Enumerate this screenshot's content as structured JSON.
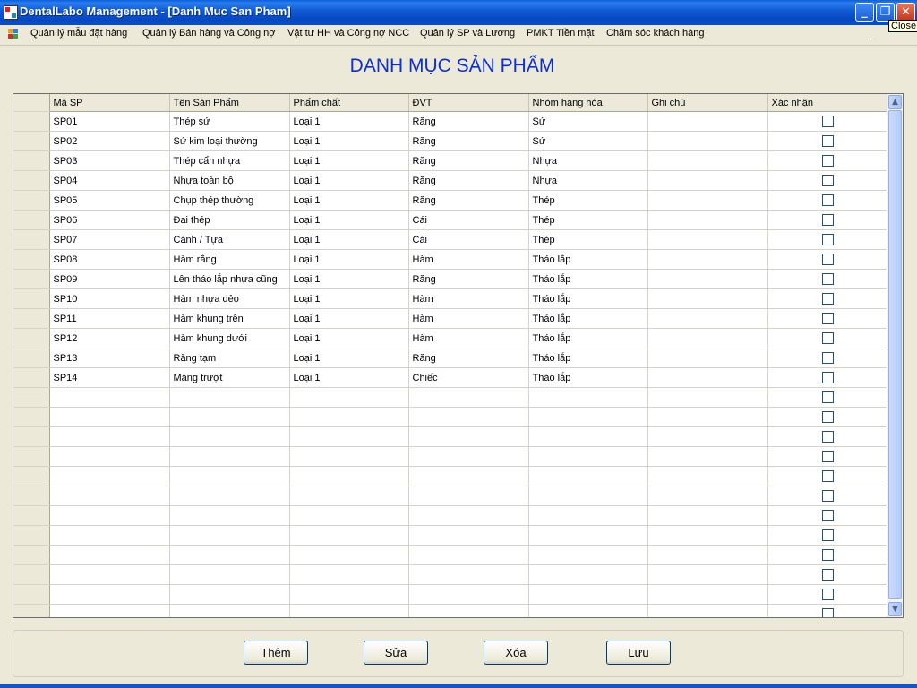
{
  "window": {
    "title": "DentalLabo Management - [Danh Muc San Pham]",
    "tooltip": "Close"
  },
  "menu": {
    "items": [
      "Quản lý mẫu đặt hàng",
      "Quản lý Bán hàng và Công nợ",
      "Vật tư HH và Công nợ NCC",
      "Quản lý SP và Lương",
      "PMKT Tiền mặt",
      "Chăm sóc khách hàng"
    ]
  },
  "heading": "DANH MỤC SẢN PHẨM",
  "grid": {
    "columns": [
      "Mã SP",
      "Tên Sản Phẩm",
      "Phẩm chất",
      "ĐVT",
      "Nhóm hàng hóa",
      "Ghi chú",
      "Xác nhận"
    ],
    "rows": [
      [
        "SP01",
        "Thép sứ",
        "Loại 1",
        "Răng",
        "Sứ",
        ""
      ],
      [
        "SP02",
        "Sứ kim loại thường",
        "Loại 1",
        "Răng",
        "Sứ",
        ""
      ],
      [
        "SP03",
        "Thép cẩn nhựa",
        "Loại 1",
        "Răng",
        "Nhựa",
        ""
      ],
      [
        "SP04",
        "Nhựa toàn bộ",
        "Loại 1",
        "Răng",
        "Nhựa",
        ""
      ],
      [
        "SP05",
        "Chụp thép thường",
        "Loại 1",
        "Răng",
        "Thép",
        ""
      ],
      [
        "SP06",
        "Đai thép",
        "Loại 1",
        "Cái",
        "Thép",
        ""
      ],
      [
        "SP07",
        "Cánh / Tựa",
        "Loại 1",
        "Cái",
        "Thép",
        ""
      ],
      [
        "SP08",
        "Hàm rằng",
        "Loại 1",
        "Hàm",
        "Tháo lắp",
        ""
      ],
      [
        "SP09",
        "Lên tháo lắp nhựa cũng",
        "Loại 1",
        "Răng",
        "Tháo lắp",
        ""
      ],
      [
        "SP10",
        "Hàm nhựa dẻo",
        "Loại 1",
        "Hàm",
        "Tháo lắp",
        ""
      ],
      [
        "SP11",
        "Hàm khung trên",
        "Loại 1",
        "Hàm",
        "Tháo lắp",
        ""
      ],
      [
        "SP12",
        "Hàm khung dưới",
        "Loại 1",
        "Hàm",
        "Tháo lắp",
        ""
      ],
      [
        "SP13",
        "Răng tạm",
        "Loại 1",
        "Răng",
        "Tháo lắp",
        ""
      ],
      [
        "SP14",
        "Máng trượt",
        "Loại 1",
        "Chiếc",
        "Tháo lắp",
        ""
      ],
      [
        "",
        "",
        "",
        "",
        "",
        ""
      ],
      [
        "",
        "",
        "",
        "",
        "",
        ""
      ],
      [
        "",
        "",
        "",
        "",
        "",
        ""
      ],
      [
        "",
        "",
        "",
        "",
        "",
        ""
      ],
      [
        "",
        "",
        "",
        "",
        "",
        ""
      ],
      [
        "",
        "",
        "",
        "",
        "",
        ""
      ],
      [
        "",
        "",
        "",
        "",
        "",
        ""
      ],
      [
        "",
        "",
        "",
        "",
        "",
        ""
      ],
      [
        "",
        "",
        "",
        "",
        "",
        ""
      ],
      [
        "",
        "",
        "",
        "",
        "",
        ""
      ],
      [
        "",
        "",
        "",
        "",
        "",
        ""
      ],
      [
        "",
        "",
        "",
        "",
        "",
        ""
      ]
    ]
  },
  "buttons": {
    "add": "Thêm",
    "edit": "Sửa",
    "delete": "Xóa",
    "save": "Lưu"
  },
  "colors": {
    "titlebar": "#0a4fc6",
    "heading": "#0b2fd0",
    "window_bg": "#ece9d8"
  }
}
